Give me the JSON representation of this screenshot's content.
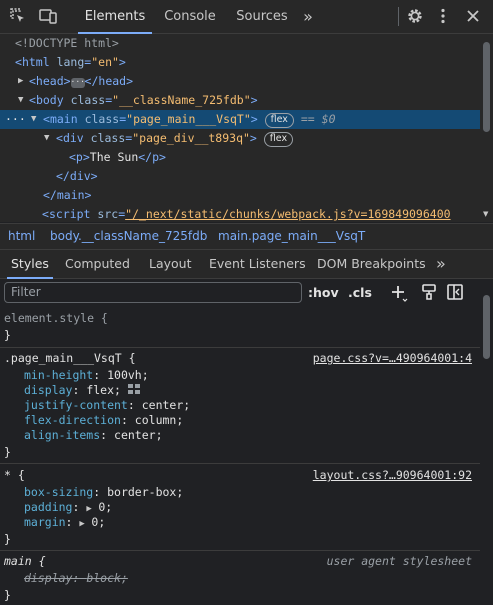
{
  "toolbar": {
    "tabs": [
      "Elements",
      "Console",
      "Sources"
    ],
    "active_tab": "Elements",
    "more_tabs": "»"
  },
  "dom": {
    "doctype": "<!DOCTYPE html>",
    "html_tag": "html",
    "html_attr": "lang",
    "html_val": "\"en\"",
    "head_open": "<head>",
    "head_close": "</head>",
    "body_tag": "body",
    "body_attr": "class",
    "body_val": "\"__className_725fdb\"",
    "main_tag": "main",
    "main_attr": "class",
    "main_val": "\"page_main___VsqT\"",
    "main_badge": "flex",
    "main_eq": "== $0",
    "div_tag": "div",
    "div_attr": "class",
    "div_val": "\"page_div__t893q\"",
    "div_badge": "flex",
    "p_open": "<p>",
    "p_text": "The Sun",
    "p_close": "</p>",
    "div_close": "</div>",
    "main_close": "</main>",
    "script_tag": "script",
    "script_attr": "src",
    "script_val": "\"/_next/static/chunks/webpack.js?v=169849096400"
  },
  "breadcrumb": [
    "html",
    "body.__className_725fdb",
    "main.page_main___VsqT"
  ],
  "styles_tabs": [
    "Styles",
    "Computed",
    "Layout",
    "Event Listeners",
    "DOM Breakpoints"
  ],
  "styles_more": "»",
  "filter": {
    "placeholder": "Filter"
  },
  "filter_buttons": {
    "hov": ":hov",
    "cls": ".cls"
  },
  "rules": {
    "element_style": {
      "selector": "element.style {",
      "close": "}"
    },
    "page_main": {
      "selector": ".page_main___VsqT {",
      "source": "page.css?v=…490964001:4",
      "props": [
        {
          "name": "min-height",
          "value": "100vh;"
        },
        {
          "name": "display",
          "value": "flex;"
        },
        {
          "name": "justify-content",
          "value": "center;"
        },
        {
          "name": "flex-direction",
          "value": "column;"
        },
        {
          "name": "align-items",
          "value": "center;"
        }
      ],
      "close": "}"
    },
    "universal": {
      "selector": "* {",
      "source": "layout.css?…90964001:92",
      "props": [
        {
          "name": "box-sizing",
          "value": "border-box;"
        },
        {
          "name": "padding",
          "value": "0;"
        },
        {
          "name": "margin",
          "value": "0;"
        }
      ],
      "close": "}"
    },
    "main_ua": {
      "selector": "main {",
      "source": "user agent stylesheet",
      "prop": {
        "name": "display",
        "value": "block;"
      },
      "close": "}"
    }
  },
  "colors": {
    "accent": "#7cacf8",
    "selected_row": "#144a74",
    "background": "#202124"
  },
  "icons": [
    "inspect-element-icon",
    "device-toolbar-icon",
    "settings-gear-icon",
    "more-vert-icon",
    "close-icon",
    "new-style-rule-icon",
    "toggle-element-state-icon",
    "computed-sidebar-icon",
    "flex-editor-icon"
  ]
}
